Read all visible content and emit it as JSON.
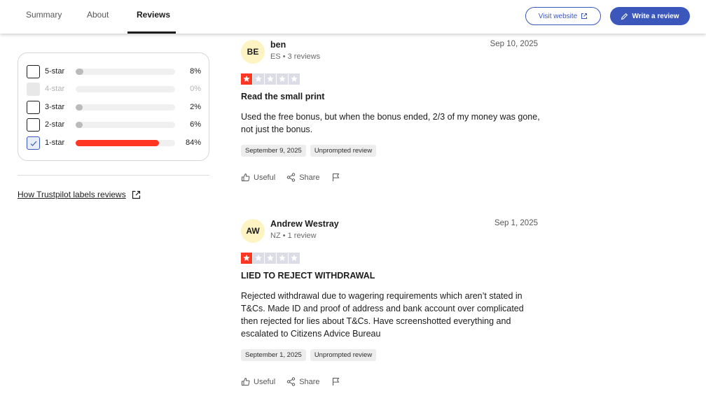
{
  "tabs": [
    {
      "label": "Summary"
    },
    {
      "label": "About"
    },
    {
      "label": "Reviews"
    }
  ],
  "header": {
    "visit_label": "Visit website",
    "write_label": "Write a review",
    "accent_color": "#3c57bc"
  },
  "filters": [
    {
      "label": "5-star",
      "pct": "8%",
      "fill": 0.08,
      "state": "unchecked"
    },
    {
      "label": "4-star",
      "pct": "0%",
      "fill": 0.0,
      "state": "disabled"
    },
    {
      "label": "3-star",
      "pct": "2%",
      "fill": 0.02,
      "state": "unchecked"
    },
    {
      "label": "2-star",
      "pct": "6%",
      "fill": 0.06,
      "state": "unchecked"
    },
    {
      "label": "1-star",
      "pct": "84%",
      "fill": 0.84,
      "state": "checked"
    }
  ],
  "how_link": "How Trustpilot labels reviews",
  "reviews": [
    {
      "initials": "BE",
      "name": "ben",
      "meta": "ES • 3 reviews",
      "date": "Sep 10, 2025",
      "rating": 1,
      "title": "Read the small print",
      "body": "Used the free bonus, but when the bonus ended, 2/3 of my money was gone, not just the bonus.",
      "experience_date": "September 9, 2025",
      "tag": "Unprompted review",
      "useful": "Useful",
      "share": "Share"
    },
    {
      "initials": "AW",
      "name": "Andrew Westray",
      "meta": "NZ • 1 review",
      "date": "Sep 1, 2025",
      "rating": 1,
      "title": "LIED TO REJECT WITHDRAWAL",
      "body": "Rejected withdrawal due to wagering requirements which aren’t stated in T&Cs. Made ID and proof of address and bank account over complicated then rejected for lies about T&Cs. Have screenshotted everything and escalated to Citizens Advice Bureau",
      "experience_date": "September 1, 2025",
      "tag": "Unprompted review",
      "useful": "Useful",
      "share": "Share"
    }
  ]
}
